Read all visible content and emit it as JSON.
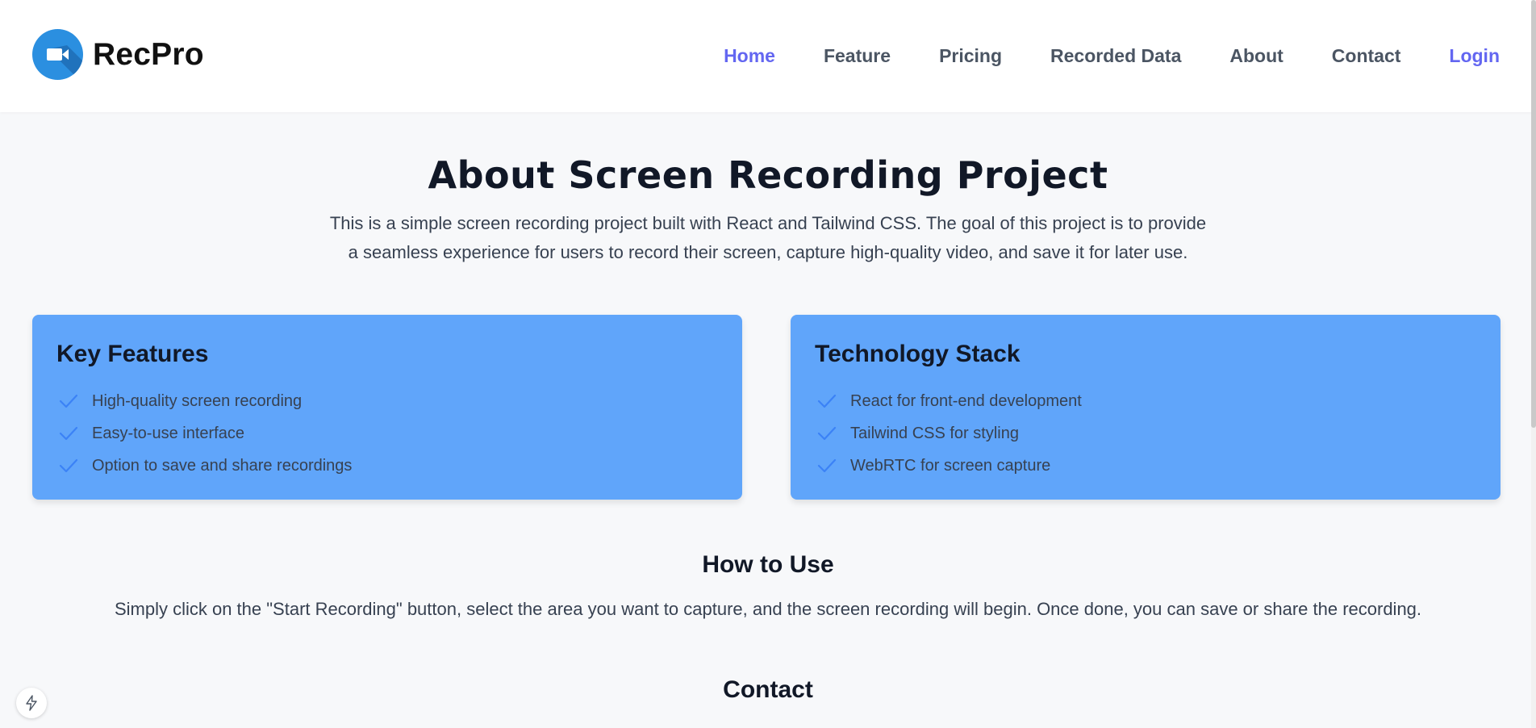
{
  "header": {
    "brand_name": "RecPro",
    "logo_icon": "video-camera-icon",
    "nav": [
      {
        "label": "Home",
        "active": true
      },
      {
        "label": "Feature"
      },
      {
        "label": "Pricing"
      },
      {
        "label": "Recorded Data"
      },
      {
        "label": "About"
      },
      {
        "label": "Contact"
      },
      {
        "label": "Login"
      }
    ]
  },
  "main": {
    "title": "About Screen Recording Project",
    "intro_line1": "This is a simple screen recording project built with React and Tailwind CSS. The goal of this project is to provide",
    "intro_line2": "a seamless experience for users to record their screen, capture high-quality video, and save it for later use.",
    "cards": [
      {
        "title": "Key Features",
        "items": [
          "High-quality screen recording",
          "Easy-to-use interface",
          "Option to save and share recordings"
        ]
      },
      {
        "title": "Technology Stack",
        "items": [
          "React for front-end development",
          "Tailwind CSS for styling",
          "WebRTC for screen capture"
        ]
      }
    ],
    "how_to_use": {
      "title": "How to Use",
      "text": "Simply click on the \"Start Recording\" button, select the area you want to capture, and the screen recording will begin. Once done, you can save or share the recording."
    },
    "contact": {
      "title": "Contact"
    }
  },
  "floating_badge": {
    "icon": "lightning-bolt-icon"
  },
  "colors": {
    "accent": "#6366f1",
    "card_bg": "#60a5fa",
    "check": "#3b82f6",
    "logo_bg": "#2b8fe0",
    "page_bg": "#f7f8fa"
  }
}
